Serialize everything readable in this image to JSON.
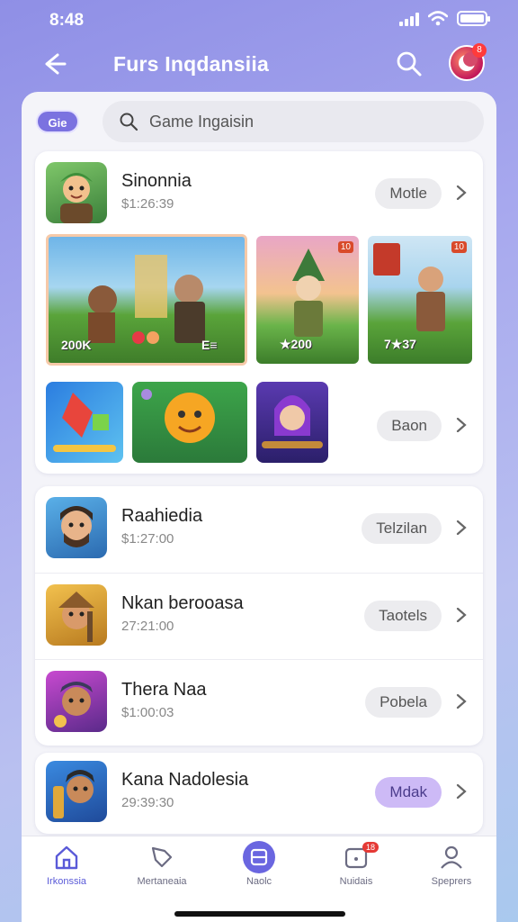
{
  "status": {
    "time": "8:48"
  },
  "header": {
    "title": "Furs Inqdansiia"
  },
  "notifications_badge": "8",
  "search": {
    "chip": "Gie",
    "placeholder": "Game Ingaisin"
  },
  "featured": {
    "title": "Sinonnia",
    "subtitle": "$1:26:39",
    "tag": "Motle",
    "screenshot_labels": [
      "200K",
      "E≡",
      "★200",
      "7★37",
      "10",
      "10"
    ],
    "second_tag": "Baon"
  },
  "list": [
    {
      "title": "Raahiedia",
      "subtitle": "$1:27:00",
      "tag": "Telzilan"
    },
    {
      "title": "Nkan berooasa",
      "subtitle": "27:21:00",
      "tag": "Taotels"
    },
    {
      "title": "Thera Naa",
      "subtitle": "$1:00:03",
      "tag": "Pobela"
    }
  ],
  "last": {
    "title": "Kana Nadolesia",
    "subtitle": "29:39:30",
    "tag": "Mdak"
  },
  "nav": [
    {
      "label": "Irkonssia",
      "icon": "home-icon",
      "active": true
    },
    {
      "label": "Mertaneaia",
      "icon": "tag-icon",
      "active": false
    },
    {
      "label": "Naolc",
      "icon": "library-icon",
      "active": false
    },
    {
      "label": "Nuidais",
      "icon": "notification-icon",
      "active": false,
      "badge": "18"
    },
    {
      "label": "Speprers",
      "icon": "profile-icon",
      "active": false
    }
  ]
}
